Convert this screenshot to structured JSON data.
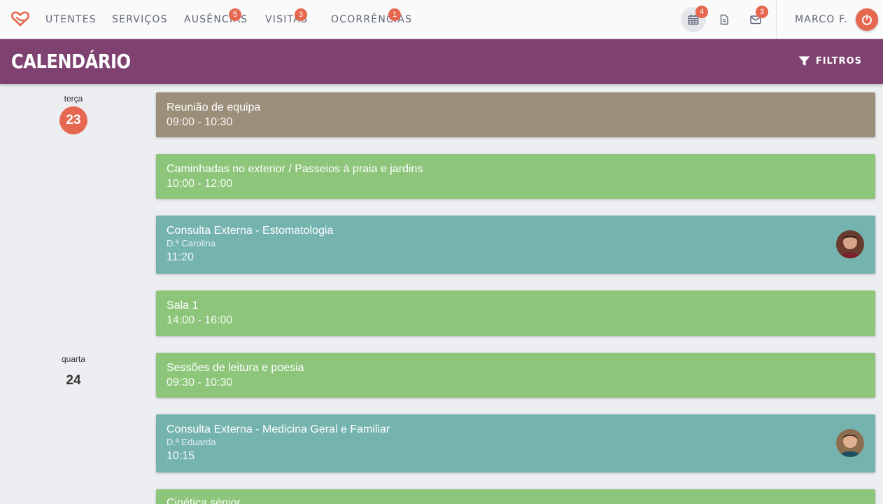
{
  "colors": {
    "accent": "#e5674f",
    "header": "#7f4270",
    "meeting": "#9c8f7a",
    "activity": "#8dc57a",
    "consult": "#74b3ae"
  },
  "nav": {
    "items": [
      {
        "label": "UTENTES"
      },
      {
        "label": "SERVIÇOS"
      },
      {
        "label": "AUSÊNCIAS",
        "badge": "5"
      },
      {
        "label": "VISITAS",
        "badge": "3"
      },
      {
        "label": "OCORRÊNCIAS",
        "badge": "1"
      }
    ],
    "icons": [
      {
        "name": "calendar-icon",
        "badge": "4"
      },
      {
        "name": "document-icon"
      },
      {
        "name": "mail-icon",
        "badge": "3"
      }
    ],
    "user": "MARCO F."
  },
  "header": {
    "title": "CALENDÁRIO",
    "filters_label": "FILTROS"
  },
  "days": [
    {
      "name": "terça",
      "number": "23",
      "today": true
    },
    {
      "name": "quarta",
      "number": "24",
      "today": false
    }
  ],
  "events": [
    {
      "title": "Reunião de equipa",
      "time": "09:00 - 10:30"
    },
    {
      "title": "Caminhadas no exterior / Passeios à praia e jardins",
      "time": "10:00 - 12:00"
    },
    {
      "title": "Consulta Externa - Estomatologia",
      "doctor": "D.ª Carolina",
      "time": "11:20"
    },
    {
      "title": "Sala 1",
      "time": "14:00 - 16:00"
    },
    {
      "title": "Sessões de leitura e poesia",
      "time": "09:30 - 10:30"
    },
    {
      "title": "Consulta Externa - Medicina Geral e Familiar",
      "doctor": "D.ª Eduarda",
      "time": "10:15"
    },
    {
      "title": "Cinética sénior"
    }
  ]
}
